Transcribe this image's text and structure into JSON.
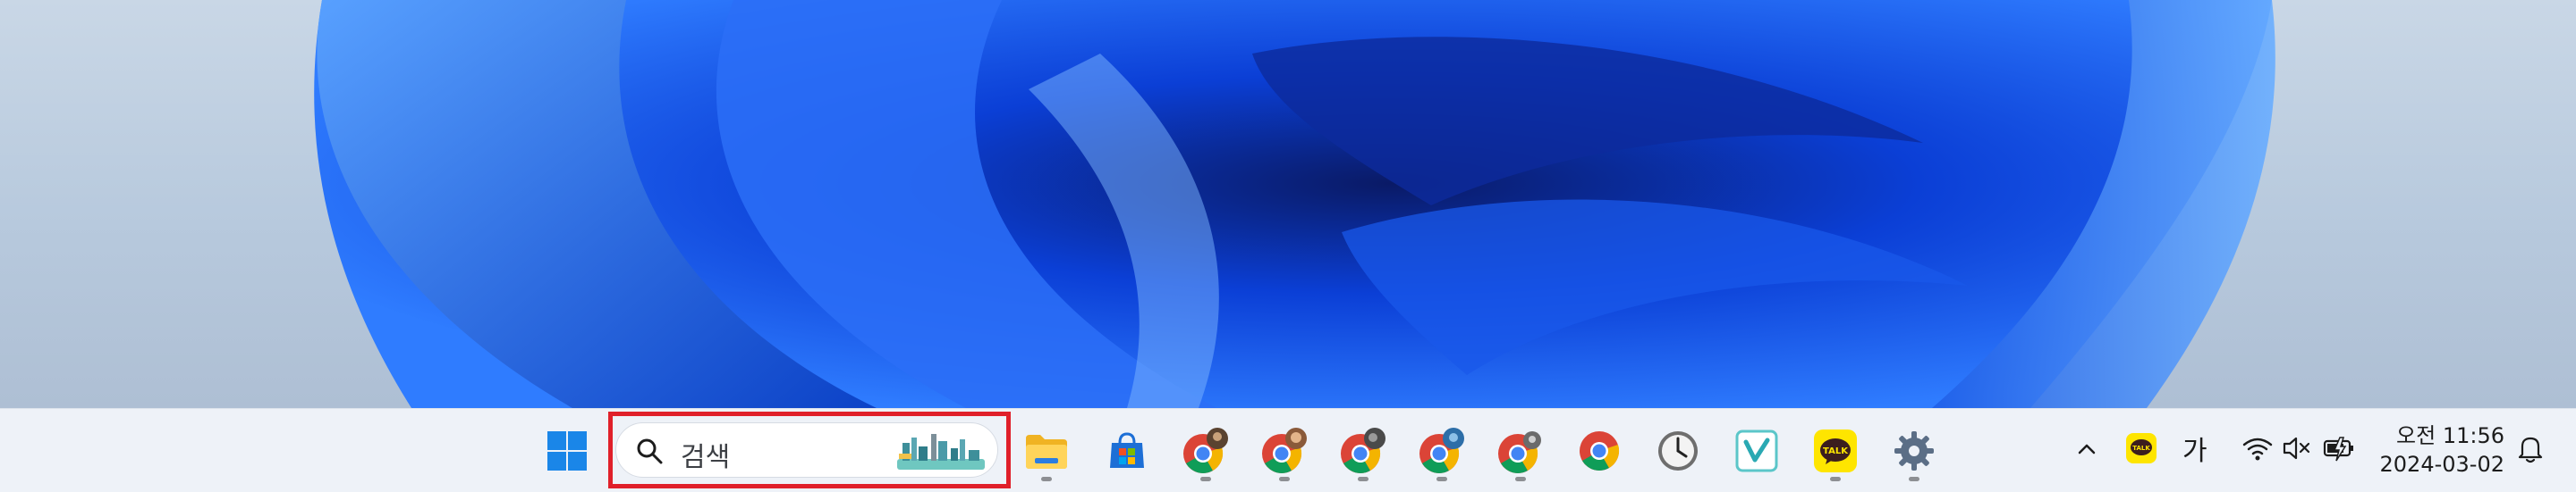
{
  "taskbar": {
    "search": {
      "placeholder": "검색"
    },
    "apps": [
      {
        "icon": "windows-start-icon",
        "running": false
      },
      {
        "icon": "file-explorer-icon",
        "running": true
      },
      {
        "icon": "microsoft-store-icon",
        "running": false
      },
      {
        "icon": "chrome-profile-1-icon",
        "running": true
      },
      {
        "icon": "chrome-profile-2-icon",
        "running": true
      },
      {
        "icon": "chrome-profile-3-icon",
        "running": true
      },
      {
        "icon": "chrome-profile-4-icon",
        "running": true
      },
      {
        "icon": "chrome-profile-5-icon",
        "running": true
      },
      {
        "icon": "chrome-icon",
        "running": false
      },
      {
        "icon": "clock-app-icon",
        "running": false
      },
      {
        "icon": "v-app-icon",
        "running": false
      },
      {
        "icon": "kakaotalk-icon",
        "running": true
      },
      {
        "icon": "settings-gear-icon",
        "running": true
      }
    ],
    "tray": {
      "kakaotalk_badge": "TALK",
      "ime_indicator": "가",
      "time": "오전 11:56",
      "date": "2024-03-02"
    },
    "colors": {
      "taskbar_bg": "#eef2f8",
      "highlight": "#e0202a",
      "accent": "#0067c0"
    }
  }
}
